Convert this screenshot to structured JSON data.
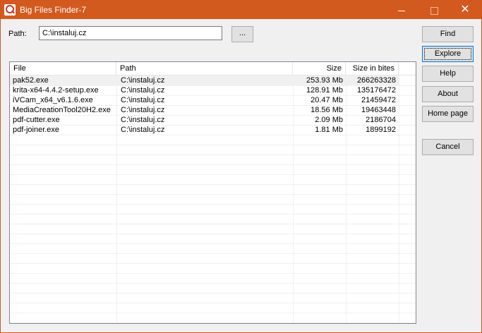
{
  "window": {
    "title": "Big Files Finder-7",
    "minimize_glyph": "",
    "close_glyph": "✕"
  },
  "path": {
    "label": "Path:",
    "value": "C:\\instaluj.cz",
    "browse_label": "..."
  },
  "buttons": {
    "find": "Find",
    "explore": "Explore",
    "help": "Help",
    "about": "About",
    "home_page": "Home page",
    "cancel": "Cancel"
  },
  "table": {
    "columns": [
      "File",
      "Path",
      "Size",
      "Size in bites"
    ],
    "rows": [
      {
        "file": "pak52.exe",
        "path": "C:\\instaluj.cz",
        "size": "253.93 Mb",
        "bytes": "266263328"
      },
      {
        "file": "krita-x64-4.4.2-setup.exe",
        "path": "C:\\instaluj.cz",
        "size": "128.91 Mb",
        "bytes": "135176472"
      },
      {
        "file": "iVCam_x64_v6.1.6.exe",
        "path": "C:\\instaluj.cz",
        "size": "20.47 Mb",
        "bytes": "21459472"
      },
      {
        "file": "MediaCreationTool20H2.exe",
        "path": "C:\\instaluj.cz",
        "size": "18.56 Mb",
        "bytes": "19463448"
      },
      {
        "file": "pdf-cutter.exe",
        "path": "C:\\instaluj.cz",
        "size": "2.09 Mb",
        "bytes": "2186704"
      },
      {
        "file": "pdf-joiner.exe",
        "path": "C:\\instaluj.cz",
        "size": "1.81 Mb",
        "bytes": "1899192"
      }
    ]
  },
  "colors": {
    "titlebar": "#d35a1e",
    "focus": "#0078d7"
  }
}
